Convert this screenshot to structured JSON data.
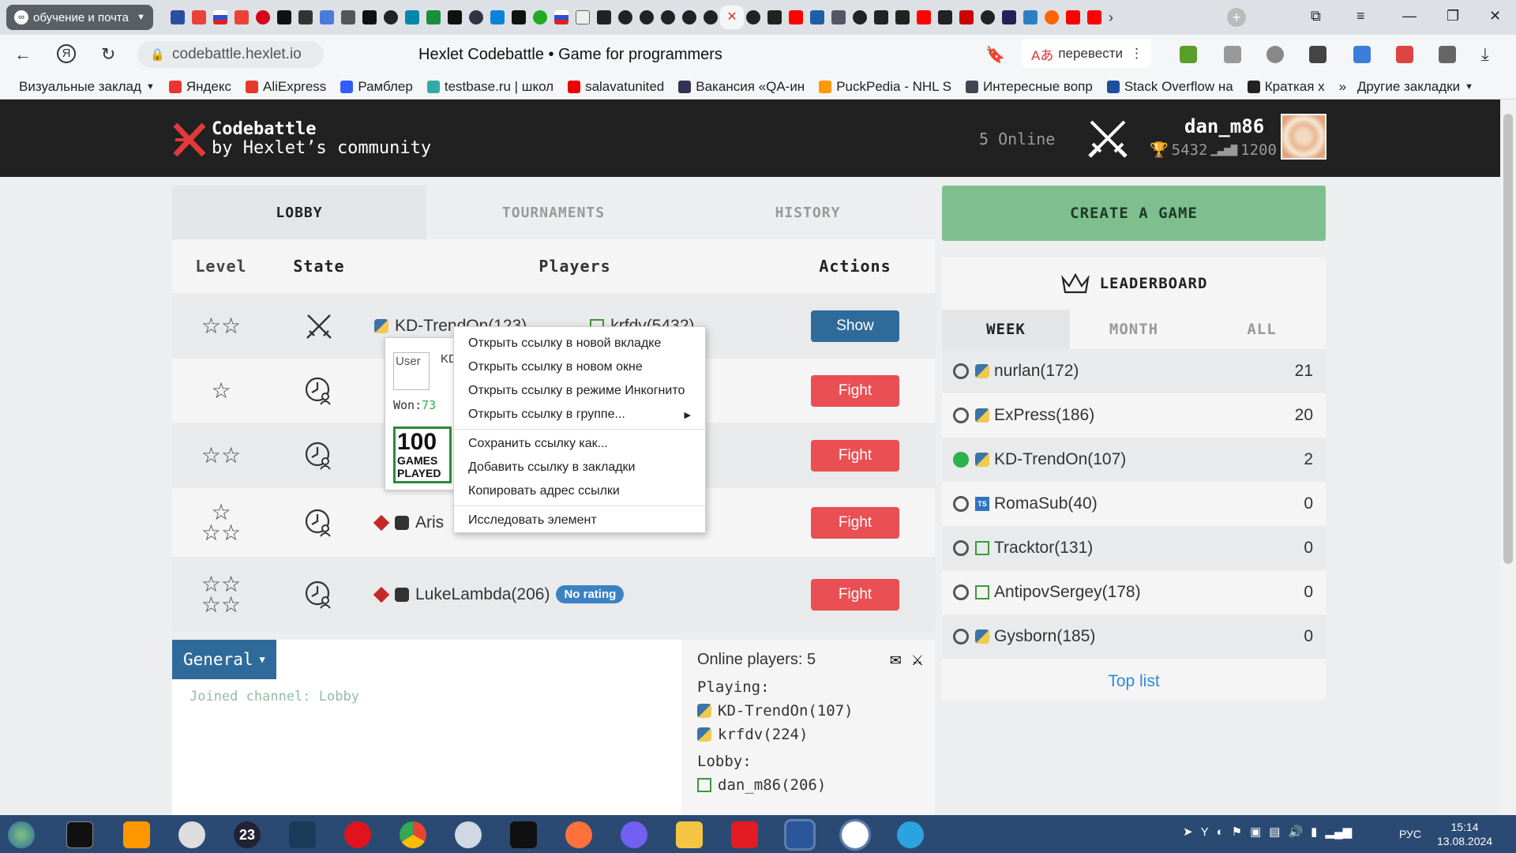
{
  "browser": {
    "tab_group_label": "обучение и почта",
    "url": "codebattle.hexlet.io",
    "page_title": "Hexlet Codebattle • Game for programmers",
    "translate_label": "перевести",
    "bookmarks": [
      {
        "label": "Визуальные заклад",
        "color": "#6a6a6a"
      },
      {
        "label": "Яндекс",
        "color": "#e33"
      },
      {
        "label": "AliExpress",
        "color": "#e4392b"
      },
      {
        "label": "Рамблер",
        "color": "#315efb"
      },
      {
        "label": "testbase.ru | школ",
        "color": "#3aa"
      },
      {
        "label": "salavatunited",
        "color": "#e00"
      },
      {
        "label": "Вакансия «QA-ин",
        "color": "#335"
      },
      {
        "label": "PuckPedia - NHL S",
        "color": "#f90"
      },
      {
        "label": "Интересные вопр",
        "color": "#445"
      },
      {
        "label": "Stack Overflow на",
        "color": "#1b4fa0"
      },
      {
        "label": "Краткая х",
        "color": "#222"
      }
    ],
    "bookmarks_more": "»",
    "other_bookmarks": "Другие закладки"
  },
  "header": {
    "logo_line1": "Codebattle",
    "logo_line2": "by Hexlet’s community",
    "online": "5 Online",
    "username": "dan_m86",
    "rating": "5432",
    "games": "1200"
  },
  "lobby": {
    "tabs": [
      "LOBBY",
      "TOURNAMENTS",
      "HISTORY"
    ],
    "columns": [
      "Level",
      "State",
      "Players",
      "Actions"
    ],
    "rows": [
      {
        "level": "☆☆",
        "player1": "KD-TrendOn(123)",
        "player2": "krfdv(5432)",
        "action": "Show"
      },
      {
        "level": "☆",
        "player1": "",
        "player2": "",
        "action": "Fight"
      },
      {
        "level": "☆☆",
        "player1": "",
        "player2": "",
        "action": "Fight"
      },
      {
        "level_top": "☆",
        "level_bottom": "☆☆",
        "player1": "Aris",
        "player2": "",
        "action": "Fight"
      },
      {
        "level_top": "☆☆",
        "level_bottom": "☆☆",
        "player1": "LukeLambda(206)",
        "badge": "No rating",
        "action": "Fight"
      }
    ]
  },
  "hover_card": {
    "img_alt": "User",
    "name_frag": "KD",
    "won_label": "Won:",
    "won_value": "73",
    "badge_big": "100",
    "badge_l1": "GAMES",
    "badge_l2": "PLAYED"
  },
  "context_menu": [
    "Открыть ссылку в новой вкладке",
    "Открыть ссылку в новом окне",
    "Открыть ссылку в режиме Инкогнито",
    "Открыть ссылку в группе...",
    "Сохранить ссылку как...",
    "Добавить ссылку в закладки",
    "Копировать адрес ссылки",
    "Исследовать элемент"
  ],
  "chat": {
    "channel_button": "General",
    "message": "Joined channel: Lobby",
    "online_title": "Online players: 5",
    "playing_label": "Playing:",
    "playing": [
      "KD-TrendOn(107)",
      "krfdv(224)"
    ],
    "lobby_label": "Lobby:",
    "lobby": [
      "dan_m86(206)"
    ]
  },
  "create_game": "CREATE A GAME",
  "leaderboard": {
    "title": "LEADERBOARD",
    "tabs": [
      "WEEK",
      "MONTH",
      "ALL"
    ],
    "rows": [
      {
        "name": "nurlan(172)",
        "score": "21",
        "lang": "python",
        "online": false
      },
      {
        "name": "ExPress(186)",
        "score": "20",
        "lang": "python",
        "online": false
      },
      {
        "name": "KD-TrendOn(107)",
        "score": "2",
        "lang": "python",
        "online": true
      },
      {
        "name": "RomaSub(40)",
        "score": "0",
        "lang": "ts",
        "online": false
      },
      {
        "name": "Tracktor(131)",
        "score": "0",
        "lang": "js",
        "online": false
      },
      {
        "name": "AntipovSergey(178)",
        "score": "0",
        "lang": "js",
        "online": false
      },
      {
        "name": "Gysborn(185)",
        "score": "0",
        "lang": "python",
        "online": false
      }
    ],
    "ts_label": "TS",
    "top_list": "Top list"
  },
  "taskbar": {
    "lang": "РУС",
    "time": "15:14",
    "date": "13.08.2024",
    "badge_23": "23"
  },
  "colors": {
    "header_bg": "#212121",
    "fight": "#e94f53",
    "show": "#2f6b9a",
    "create": "#7fbf8e",
    "online": "#2bb24c"
  }
}
